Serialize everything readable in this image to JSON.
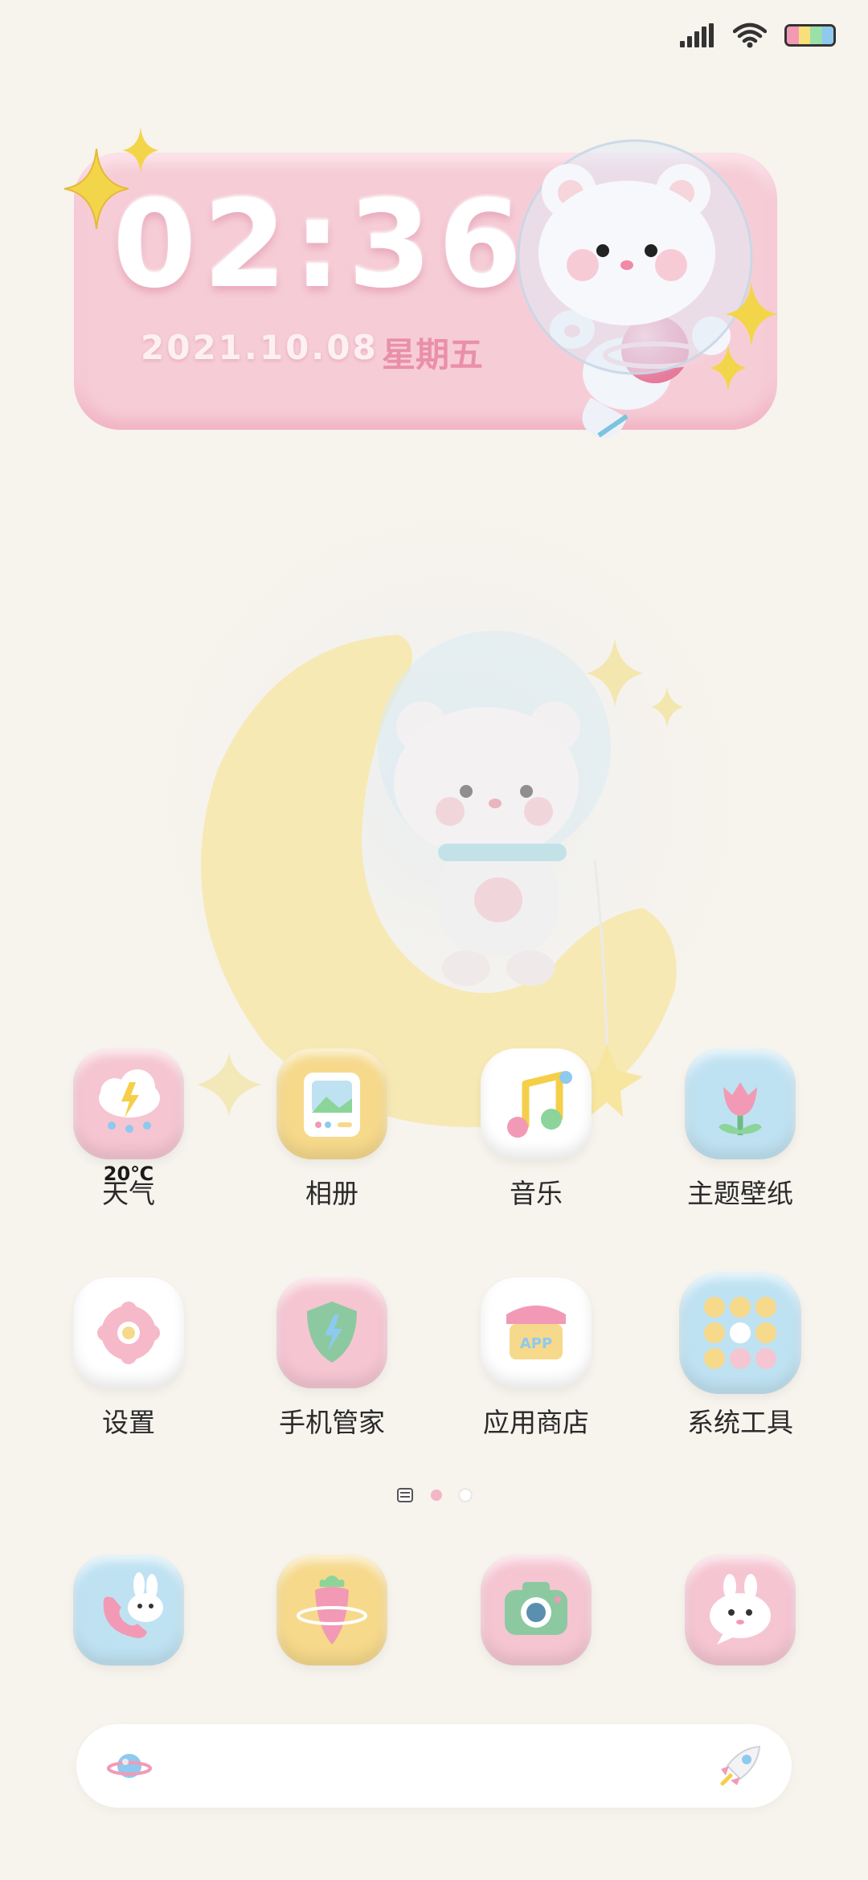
{
  "status_bar": {
    "signal_icon": "cellular-signal-icon",
    "wifi_icon": "wifi-icon",
    "battery_icon": "battery-icon",
    "battery_colors": [
      "#f29ab5",
      "#f7e07a",
      "#9be0a8",
      "#8ec9f0"
    ]
  },
  "clock_widget": {
    "time": "02:36",
    "date": "2021.10.08",
    "weekday": "星期五",
    "background": "#f6cdd7",
    "mascot_icon": "astronaut-bear-icon"
  },
  "wallpaper": {
    "subject": "bear-on-moon-icon"
  },
  "apps_row1": [
    {
      "label": "天气",
      "temp": "20℃",
      "icon": "weather-cloud-icon",
      "bg": "#f5c5d2"
    },
    {
      "label": "相册",
      "icon": "photo-frame-icon",
      "bg": "#f6d98b"
    },
    {
      "label": "音乐",
      "icon": "music-note-icon",
      "bg": "#ffffff"
    },
    {
      "label": "主题壁纸",
      "icon": "tulip-icon",
      "bg": "#bfe2f2"
    }
  ],
  "apps_row2": [
    {
      "label": "设置",
      "icon": "gear-donut-icon",
      "bg": "#ffffff"
    },
    {
      "label": "手机管家",
      "icon": "shield-icon",
      "bg": "#f5c5d2"
    },
    {
      "label": "应用商店",
      "icon": "app-store-icon",
      "bg": "#ffffff"
    },
    {
      "label": "系统工具",
      "icon": "tools-folder-icon",
      "bg": "#bfe2f2"
    }
  ],
  "page_indicator": {
    "pages": 3,
    "current": 1
  },
  "dock": [
    {
      "icon": "phone-bunny-icon",
      "bg": "#bfe2f2"
    },
    {
      "icon": "carrot-planet-icon",
      "bg": "#f6d98b"
    },
    {
      "icon": "camera-icon",
      "bg": "#f5c5d2"
    },
    {
      "icon": "message-bunny-icon",
      "bg": "#f5c5d2"
    }
  ],
  "search_bar": {
    "left_icon": "planet-icon",
    "right_icon": "rocket-icon"
  }
}
